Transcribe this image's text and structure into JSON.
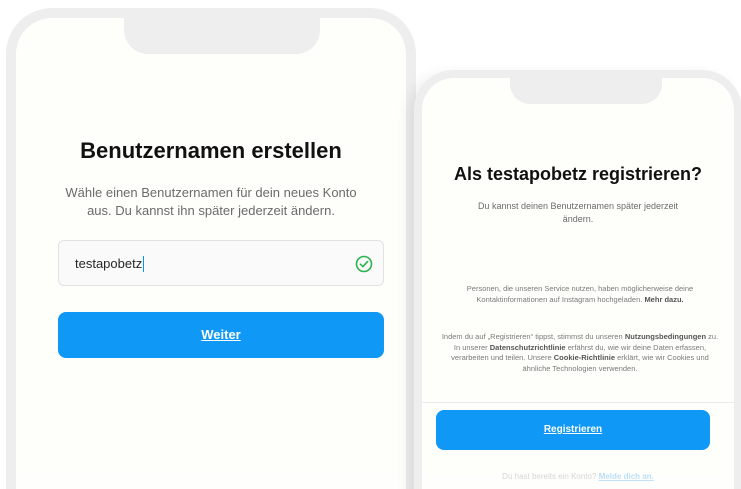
{
  "left_screen": {
    "title": "Benutzernamen erstellen",
    "subtitle": "Wähle einen Benutzernamen für dein neues Konto aus. Du kannst ihn später jederzeit ändern.",
    "username_value": "testapobetz",
    "next_button": "Weiter",
    "valid_icon": "check-circle-icon"
  },
  "right_screen": {
    "title": "Als testapobetz registrieren?",
    "subtitle": "Du kannst deinen Benutzernamen später jederzeit ändern.",
    "contacts_info": "Personen, die unseren Service nutzen, haben möglicherweise deine Kontaktinformationen auf Instagram hochgeladen.",
    "contacts_more": "Mehr dazu.",
    "terms_1": "Indem du auf „Registrieren“ tippst, stimmst du unseren",
    "terms_link_1": "Nutzungsbedingungen",
    "terms_2": "zu. In unserer",
    "terms_link_2": "Datenschutzrichtlinie",
    "terms_3": "erfährst du, wie wir deine Daten erfassen, verarbeiten und teilen. Unsere",
    "terms_link_3": "Cookie-Richtlinie",
    "terms_4": "erklärt, wie wir Cookies und ähnliche Technologien verwenden.",
    "register_button": "Registrieren",
    "login_prompt": "Du hast bereits ein Konto?",
    "login_link": "Melde dich an."
  },
  "colors": {
    "primary_button": "#0f98f5",
    "valid_green": "#2bb24c",
    "phone_frame": "#eeeeee"
  }
}
